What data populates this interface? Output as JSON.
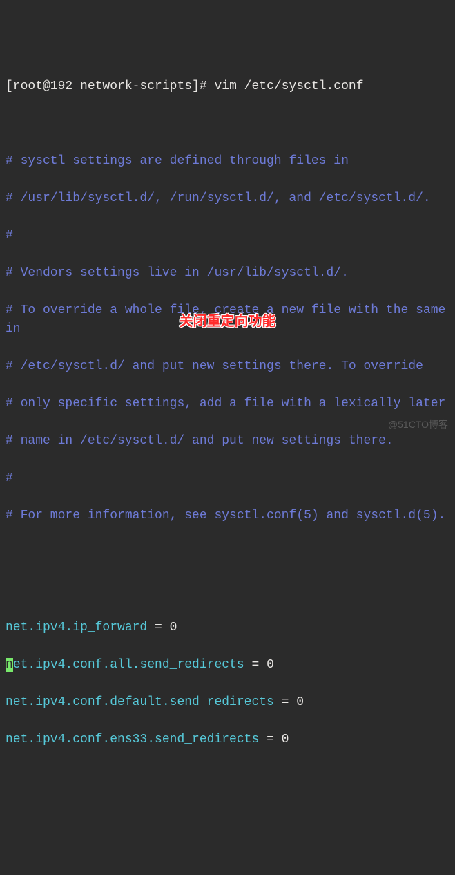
{
  "prompt": {
    "user_host": "[root@192 network-scripts]#",
    "command": "vim /etc/sysctl.conf"
  },
  "file_lines": {
    "c1": "# sysctl settings are defined through files in",
    "c2": "# /usr/lib/sysctl.d/, /run/sysctl.d/, and /etc/sysctl.d/.",
    "c3": "#",
    "c4": "# Vendors settings live in /usr/lib/sysctl.d/.",
    "c5": "# To override a whole file, create a new file with the same in",
    "c6": "# /etc/sysctl.d/ and put new settings there. To override",
    "c7": "# only specific settings, add a file with a lexically later",
    "c8": "# name in /etc/sysctl.d/ and put new settings there.",
    "c9": "#",
    "c10": "# For more information, see sysctl.conf(5) and sysctl.d(5)."
  },
  "settings": {
    "s1": {
      "key": "net.ipv4.ip_forward",
      "eq": " = ",
      "val": "0"
    },
    "s2": {
      "key_first_char": "n",
      "key_rest": "et.ipv4.conf.all.send_redirects",
      "eq": " = ",
      "val": "0"
    },
    "s3": {
      "key": "net.ipv4.conf.default.send_redirects",
      "eq": " = ",
      "val": "0"
    },
    "s4": {
      "key": "net.ipv4.conf.ens33.send_redirects",
      "eq": " = ",
      "val": "0"
    }
  },
  "annotation": "关闭重定向功能",
  "watermark": "@51CTO博客"
}
